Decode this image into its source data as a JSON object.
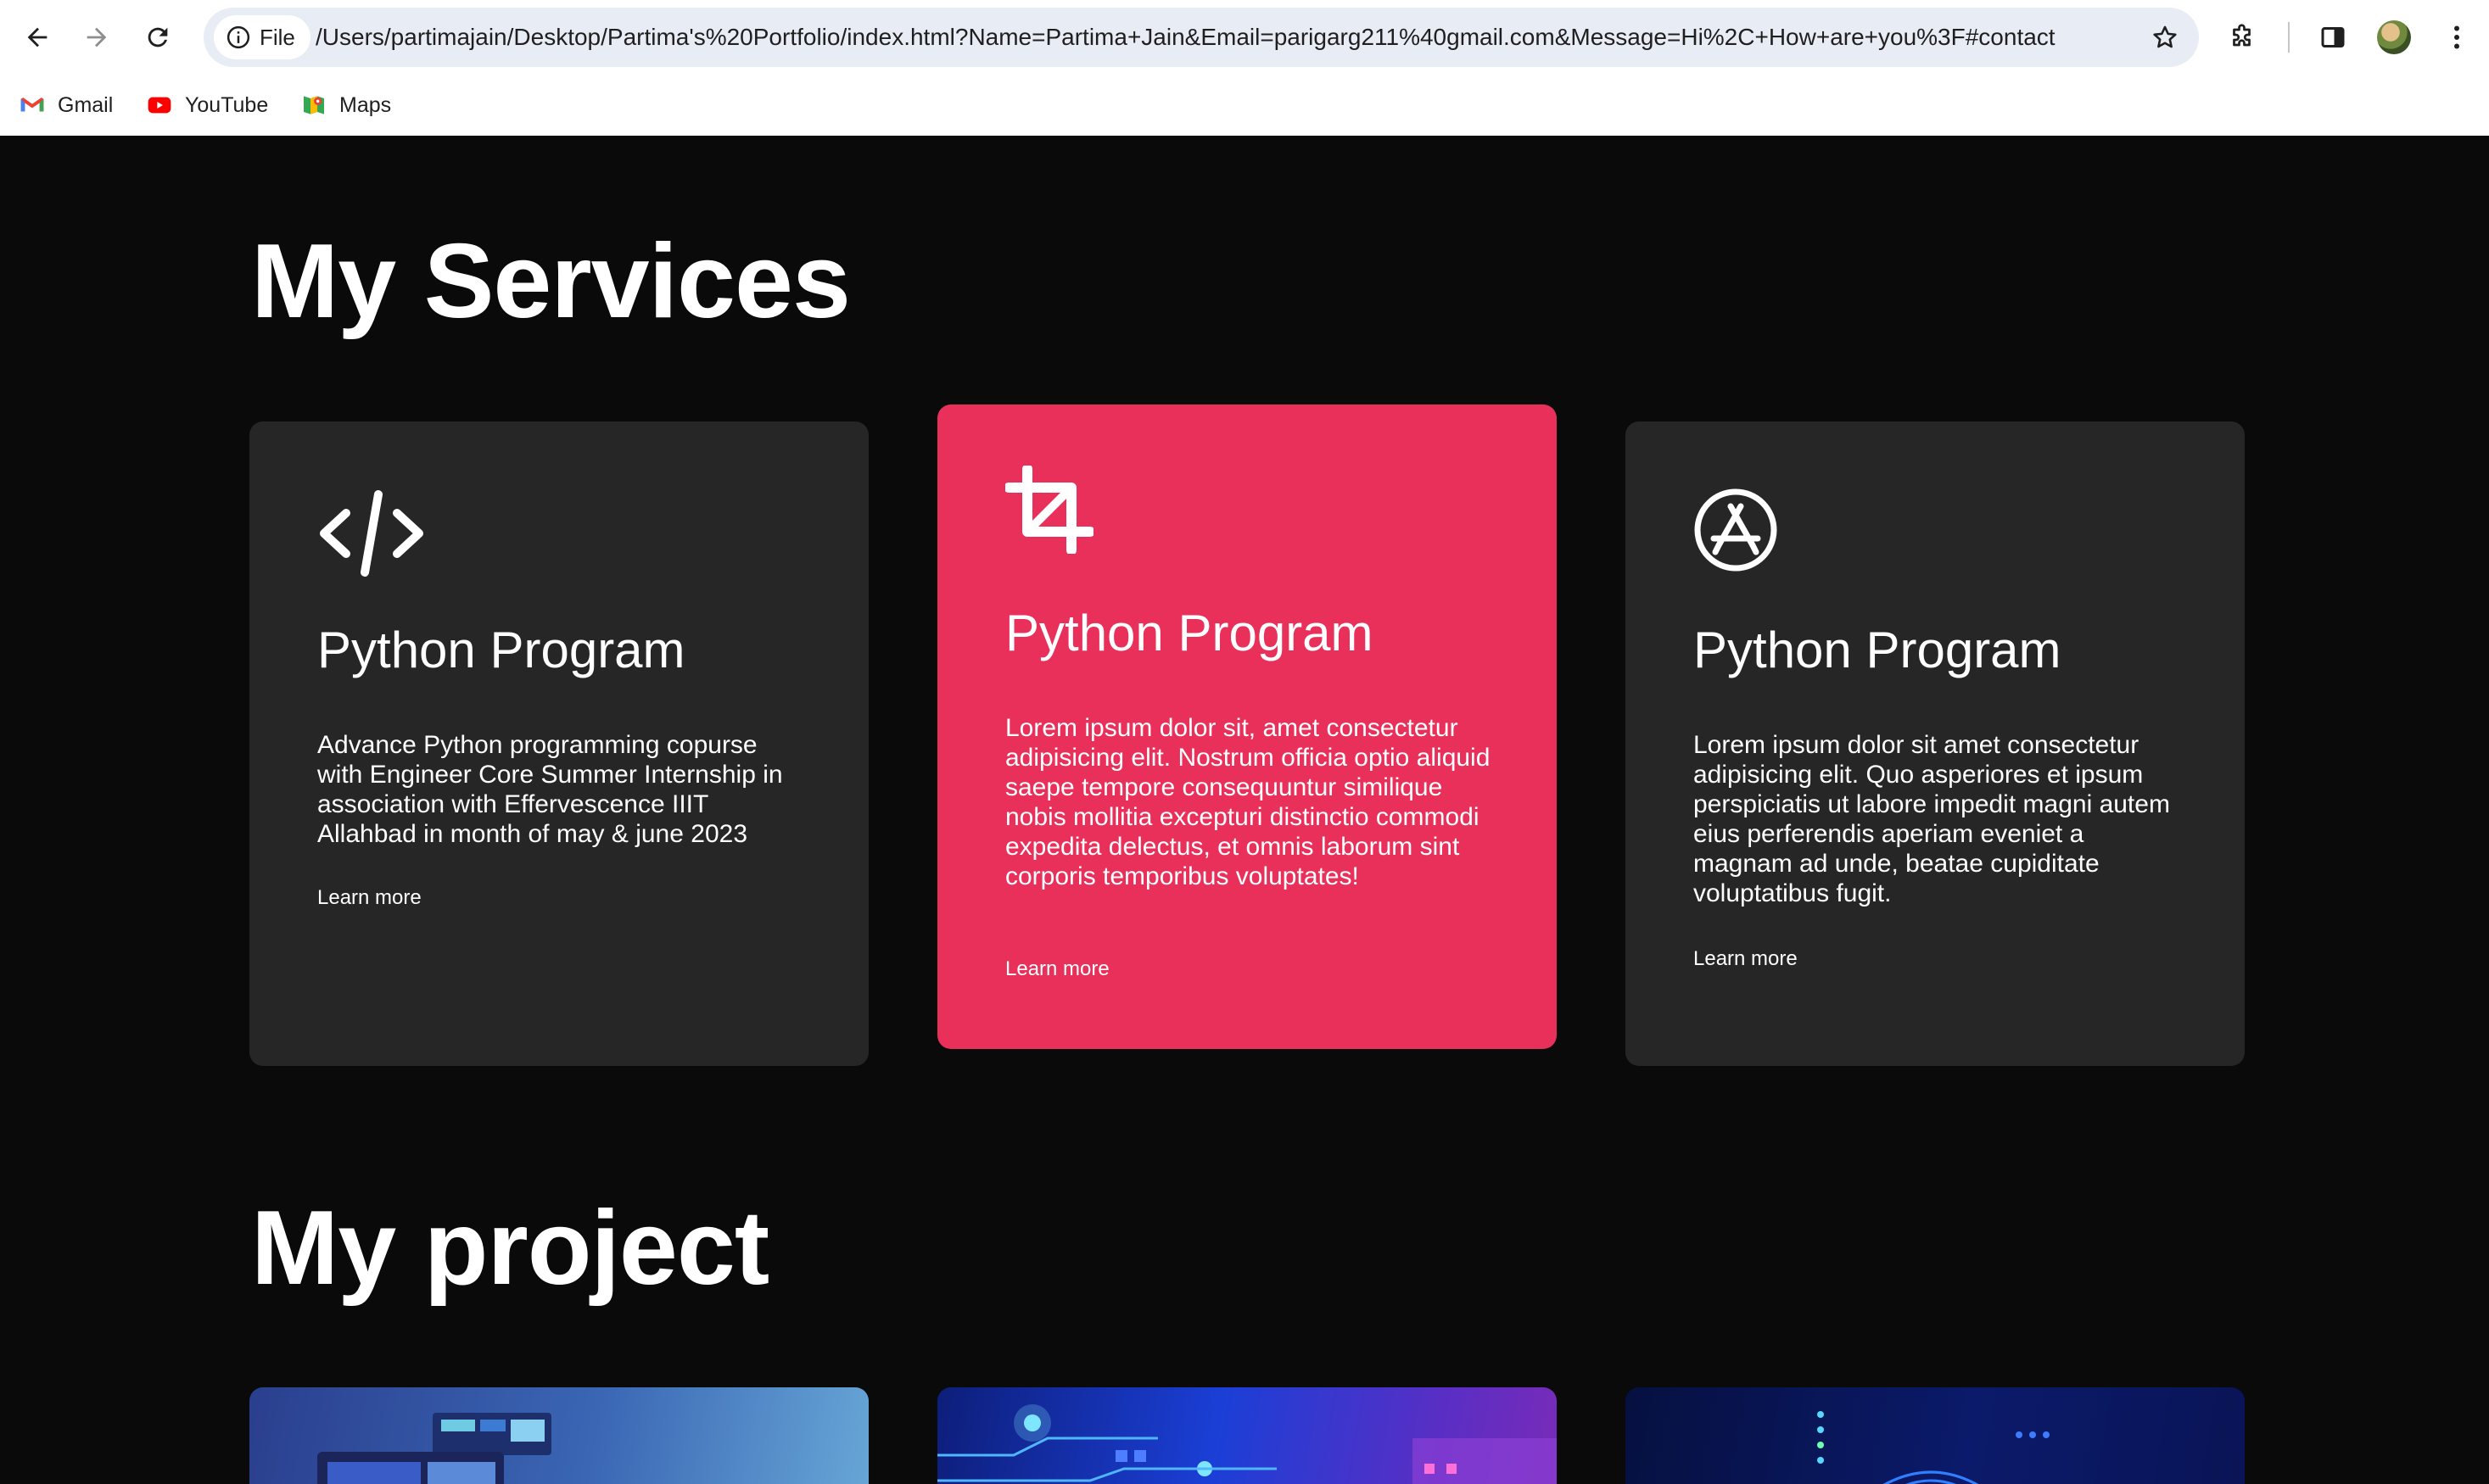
{
  "browser": {
    "url_chip_label": "File",
    "url": "/Users/partimajain/Desktop/Partima's%20Portfolio/index.html?Name=Partima+Jain&Email=parigarg211%40gmail.com&Message=Hi%2C+How+are+you%3F#contact",
    "bookmarks": [
      {
        "label": "Gmail",
        "icon": "gmail-icon"
      },
      {
        "label": "YouTube",
        "icon": "youtube-icon"
      },
      {
        "label": "Maps",
        "icon": "maps-icon"
      }
    ]
  },
  "services": {
    "title": "My Services",
    "cards": [
      {
        "icon": "code-icon",
        "title": "Python Program",
        "text": "Advance Python programming copurse with Engineer Core Summer Internship in association with Effervescence IIIT Allahbad in month of may & june 2023",
        "link": "Learn more",
        "featured": false
      },
      {
        "icon": "crop-icon",
        "title": "Python Program",
        "text": "Lorem ipsum dolor sit, amet consectetur adipisicing elit. Nostrum officia optio aliquid saepe tempore consequuntur similique nobis mollitia excepturi distinctio commodi expedita delectus, et omnis laborum sint corporis temporibus voluptates!",
        "link": "Learn more",
        "featured": true
      },
      {
        "icon": "app-store-icon",
        "title": "Python Program",
        "text": "Lorem ipsum dolor sit amet consectetur adipisicing elit. Quo asperiores et ipsum perspiciatis ut labore impedit magni autem eius perferendis aperiam eveniet a magnam ad unde, beatae cupiditate voluptatibus fugit.",
        "link": "Learn more",
        "featured": false
      }
    ]
  },
  "projects": {
    "title": "My project"
  },
  "colors": {
    "page_background": "#0a0a0b",
    "card_background": "#262626",
    "accent": "#e8305a"
  }
}
